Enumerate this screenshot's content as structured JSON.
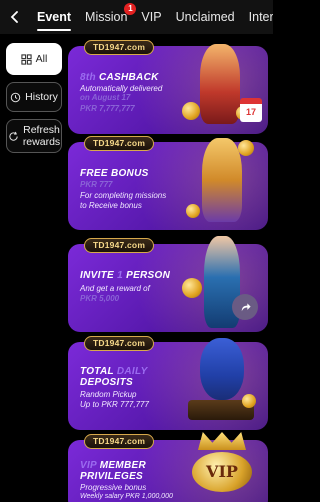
{
  "tabs": [
    {
      "label": "Event",
      "active": true
    },
    {
      "label": "Mission",
      "badge": "1"
    },
    {
      "label": "VIP"
    },
    {
      "label": "Unclaimed"
    },
    {
      "label": "Inter"
    }
  ],
  "sidebar": {
    "all": "All",
    "history": "History",
    "refresh_line1": "Refresh",
    "refresh_line2": "rewards"
  },
  "banners": [
    {
      "brand": "TD1947.com",
      "title": "8th CASHBACK",
      "title_hl": "8th",
      "line1": "Automatically delivered",
      "line2": "on August 17",
      "line3": "PKR 7,777,777"
    },
    {
      "brand": "TD1947.com",
      "title": "FREE BONUS",
      "line1": "PKR 777",
      "line2": "For completing missions",
      "line3": "to Receive bonus"
    },
    {
      "brand": "TD1947.com",
      "title_a": "INVITE",
      "title_hl": "1",
      "title_b": "PERSON",
      "line1": "And get a reward of",
      "line2": "PKR 5,000"
    },
    {
      "brand": "TD1947.com",
      "title_a": "TOTAL",
      "title_hl": "DAILY",
      "title_b": "DEPOSITS",
      "line1": "Random Pickup",
      "line2": "Up to PKR 777,777"
    },
    {
      "brand": "TD1947.com",
      "title_hl": "VIP",
      "title_b": "MEMBER",
      "title_c": "PRIVILEGES",
      "line1": "Progressive bonus",
      "line2": "Weekly salary PKR 1,000,000"
    }
  ],
  "colors": {
    "banner_purple": "#6a22c4",
    "gold": "#d7a94b",
    "badge_red": "#e32121"
  }
}
